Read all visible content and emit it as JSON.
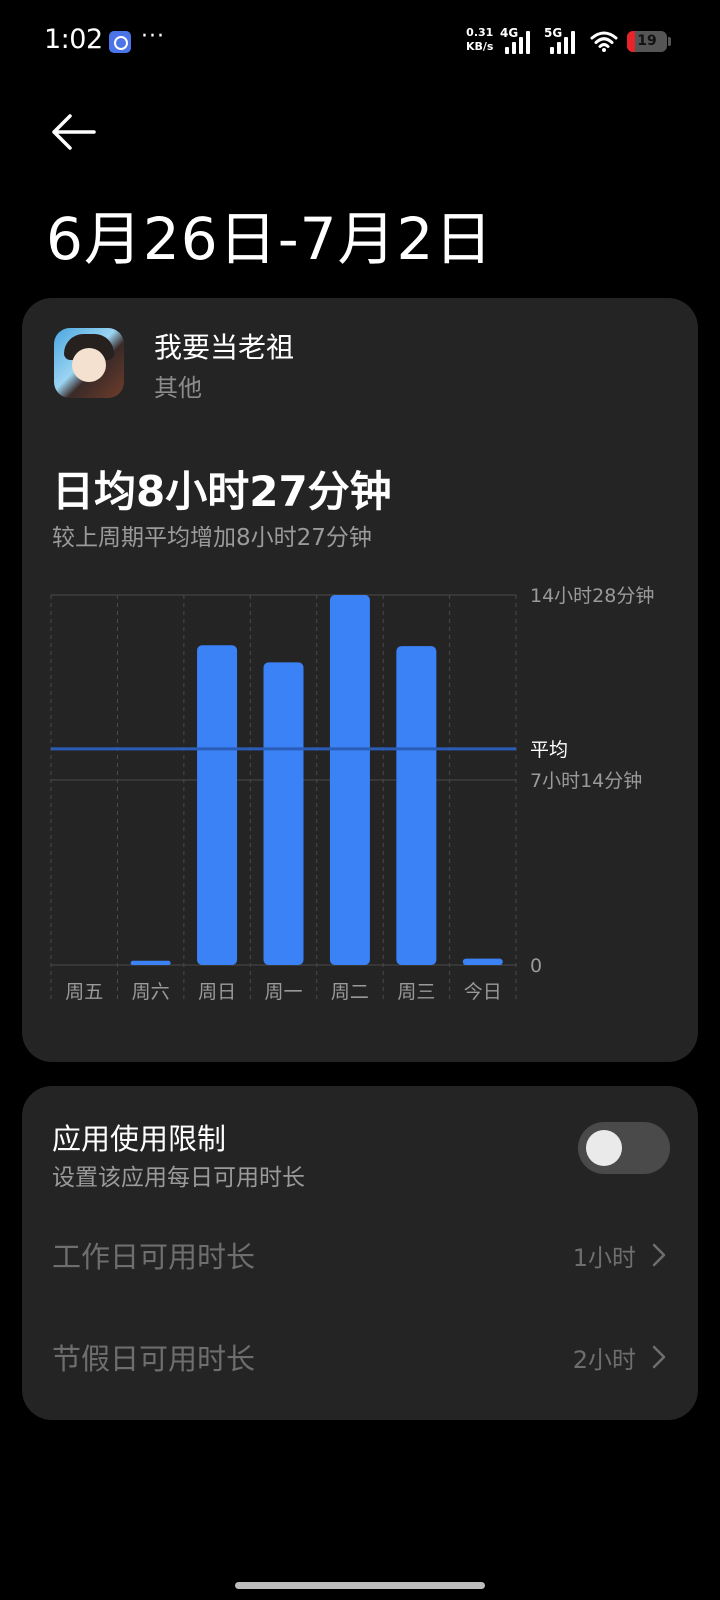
{
  "status_bar": {
    "time": "1:02",
    "dots": "···",
    "speed_value": "0.31",
    "speed_unit": "KB/s",
    "net1": "4G",
    "net2": "5G",
    "battery": "19",
    "battery_level": 0.19,
    "battery_color": "#e8242a"
  },
  "header": {
    "back_icon": "arrow-left-icon",
    "title": "6月26日-7月2日"
  },
  "app": {
    "name": "我要当老祖",
    "category": "其他"
  },
  "summary": {
    "daily_average": "日均8小时27分钟",
    "comparison": "较上周期平均增加8小时27分钟"
  },
  "chart_data": {
    "type": "bar",
    "categories": [
      "周五",
      "周六",
      "周日",
      "周一",
      "周二",
      "周三",
      "今日"
    ],
    "values_minutes": [
      0,
      10,
      750,
      710,
      868,
      748,
      15
    ],
    "y_tick_labels": [
      "14小时28分钟",
      "7小时14分钟",
      "0"
    ],
    "y_tick_values_minutes": [
      868,
      434,
      0
    ],
    "ylim_minutes": [
      0,
      868
    ],
    "average_label": "平均",
    "average_minutes": 507,
    "bar_color": "#3a82f6",
    "average_line_color": "#2a5db8",
    "grid": true
  },
  "limits": {
    "title": "应用使用限制",
    "subtitle": "设置该应用每日可用时长",
    "enabled": false,
    "workday_label": "工作日可用时长",
    "workday_value": "1小时",
    "holiday_label": "节假日可用时长",
    "holiday_value": "2小时"
  }
}
